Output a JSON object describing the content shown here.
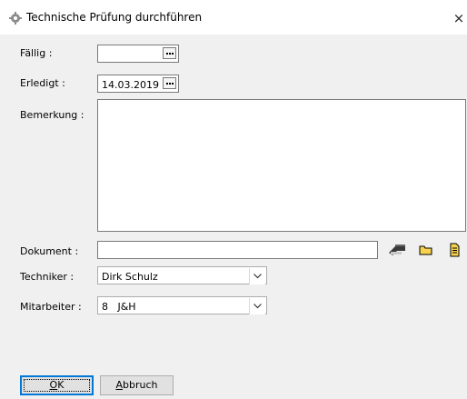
{
  "window": {
    "title": "Technische Prüfung durchführen",
    "close_glyph": "×",
    "icon": "gear-icon"
  },
  "form": {
    "faellig": {
      "label": "Fällig :",
      "value": ""
    },
    "erledigt": {
      "label": "Erledigt :",
      "value": "14.03.2019"
    },
    "bemerkung": {
      "label": "Bemerkung :",
      "value": ""
    },
    "dokument": {
      "label": "Dokument :",
      "value": ""
    },
    "techniker": {
      "label": "Techniker :",
      "value": "Dirk Schulz"
    },
    "mitarbeiter": {
      "label": "Mitarbeiter :",
      "value": "8   J&H"
    }
  },
  "buttons": {
    "ok": {
      "mnemonic": "O",
      "rest": "K"
    },
    "abbruch": {
      "mnemonic": "A",
      "rest": "bbruch"
    }
  }
}
